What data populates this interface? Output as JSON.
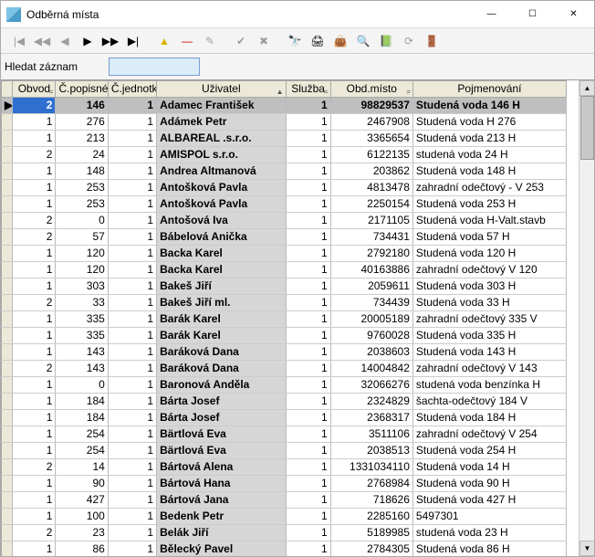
{
  "window": {
    "title": "Odběrná místa",
    "min": "—",
    "max": "☐",
    "close": "✕"
  },
  "toolbar": {
    "items": [
      {
        "name": "nav-first-icon",
        "glyph": "|◀",
        "enabled": false
      },
      {
        "name": "nav-prev-icon",
        "glyph": "◀◀",
        "enabled": false
      },
      {
        "name": "nav-back-icon",
        "glyph": "◀",
        "enabled": false
      },
      {
        "name": "nav-play-icon",
        "glyph": "▶",
        "enabled": true
      },
      {
        "name": "nav-fwd-icon",
        "glyph": "▶▶",
        "enabled": true
      },
      {
        "name": "nav-last-icon",
        "glyph": "▶|",
        "enabled": true
      },
      {
        "name": "sep"
      },
      {
        "name": "up-icon",
        "glyph": "▲",
        "enabled": true,
        "color": "#d8b400"
      },
      {
        "name": "minus-icon",
        "glyph": "—",
        "enabled": true,
        "color": "#d40000"
      },
      {
        "name": "edit-icon",
        "glyph": "✎",
        "enabled": false
      },
      {
        "name": "sep"
      },
      {
        "name": "commit-icon",
        "glyph": "✔",
        "enabled": false
      },
      {
        "name": "cancel-icon",
        "glyph": "✖",
        "enabled": false
      },
      {
        "name": "sep"
      },
      {
        "name": "binoculars-icon",
        "glyph": "🔭",
        "enabled": true
      },
      {
        "name": "print-icon",
        "glyph": "🖨",
        "enabled": true
      },
      {
        "name": "bag-icon",
        "glyph": "👜",
        "enabled": true
      },
      {
        "name": "zoom-icon",
        "glyph": "🔍",
        "enabled": true
      },
      {
        "name": "book-icon",
        "glyph": "📗",
        "enabled": true
      },
      {
        "name": "refresh-icon",
        "glyph": "⟳",
        "enabled": false
      },
      {
        "name": "door-icon",
        "glyph": "🚪",
        "enabled": true
      }
    ]
  },
  "search": {
    "label": "Hledat záznam",
    "value": ""
  },
  "columns": [
    {
      "key": "obvod",
      "label": "Obvod",
      "sort": "="
    },
    {
      "key": "popis",
      "label": "Č.popisné",
      "sort": ""
    },
    {
      "key": "jedn",
      "label": "Č.jednotk",
      "sort": ""
    },
    {
      "key": "uziv",
      "label": "Uživatel",
      "sort": "▲"
    },
    {
      "key": "sluz",
      "label": "Služba",
      "sort": "="
    },
    {
      "key": "obdm",
      "label": "Obd.místo",
      "sort": "="
    },
    {
      "key": "pojm",
      "label": "Pojmenování",
      "sort": ""
    }
  ],
  "rows": [
    {
      "sel": true,
      "obvod": "2",
      "popis": "146",
      "jedn": "1",
      "uziv": "Adamec František",
      "sluz": "1",
      "obdm": "98829537",
      "pojm": "Studená voda  146 H"
    },
    {
      "obvod": "1",
      "popis": "276",
      "jedn": "1",
      "uziv": "Adámek Petr",
      "sluz": "1",
      "obdm": "2467908",
      "pojm": "Studená voda  H  276"
    },
    {
      "obvod": "1",
      "popis": "213",
      "jedn": "1",
      "uziv": "ALBAREAL .s.r.o.",
      "sluz": "1",
      "obdm": "3365654",
      "pojm": "Studená voda   213  H"
    },
    {
      "obvod": "2",
      "popis": "24",
      "jedn": "1",
      "uziv": "AMISPOL s.r.o.",
      "sluz": "1",
      "obdm": "6122135",
      "pojm": "studená voda 24  H"
    },
    {
      "obvod": "1",
      "popis": "148",
      "jedn": "1",
      "uziv": "Andrea Altmanová",
      "sluz": "1",
      "obdm": "203862",
      "pojm": "Studená voda  148   H"
    },
    {
      "obvod": "1",
      "popis": "253",
      "jedn": "1",
      "uziv": "Antošková Pavla",
      "sluz": "1",
      "obdm": "4813478",
      "pojm": "zahradní odečtový - V  253"
    },
    {
      "obvod": "1",
      "popis": "253",
      "jedn": "1",
      "uziv": "Antošková Pavla",
      "sluz": "1",
      "obdm": "2250154",
      "pojm": "Studená voda  253   H"
    },
    {
      "obvod": "2",
      "popis": "0",
      "jedn": "1",
      "uziv": "Antošová Iva",
      "sluz": "1",
      "obdm": "2171105",
      "pojm": "Studená voda   H-Valt.stavb"
    },
    {
      "obvod": "2",
      "popis": "57",
      "jedn": "1",
      "uziv": "Bábelová Anička",
      "sluz": "1",
      "obdm": "734431",
      "pojm": "Studená voda  57   H"
    },
    {
      "obvod": "1",
      "popis": "120",
      "jedn": "1",
      "uziv": "Backa Karel",
      "sluz": "1",
      "obdm": "2792180",
      "pojm": "Studená voda  120   H"
    },
    {
      "obvod": "1",
      "popis": "120",
      "jedn": "1",
      "uziv": "Backa Karel",
      "sluz": "1",
      "obdm": "40163886",
      "pojm": "zahradní odečtový   V  120"
    },
    {
      "obvod": "1",
      "popis": "303",
      "jedn": "1",
      "uziv": "Bakeš Jiří",
      "sluz": "1",
      "obdm": "2059611",
      "pojm": "Studená voda   303   H"
    },
    {
      "obvod": "2",
      "popis": "33",
      "jedn": "1",
      "uziv": "Bakeš Jiří ml.",
      "sluz": "1",
      "obdm": "734439",
      "pojm": "Studená voda  33   H"
    },
    {
      "obvod": "1",
      "popis": "335",
      "jedn": "1",
      "uziv": "Barák Karel",
      "sluz": "1",
      "obdm": "20005189",
      "pojm": "zahradní odečtový 335   V"
    },
    {
      "obvod": "1",
      "popis": "335",
      "jedn": "1",
      "uziv": "Barák Karel",
      "sluz": "1",
      "obdm": "9760028",
      "pojm": "Studená voda 335   H"
    },
    {
      "obvod": "1",
      "popis": "143",
      "jedn": "1",
      "uziv": "Baráková Dana",
      "sluz": "1",
      "obdm": "2038603",
      "pojm": "Studená voda 143  H"
    },
    {
      "obvod": "2",
      "popis": "143",
      "jedn": "1",
      "uziv": "Baráková Dana",
      "sluz": "1",
      "obdm": "14004842",
      "pojm": "zahradní odečtový V  143"
    },
    {
      "obvod": "1",
      "popis": "0",
      "jedn": "1",
      "uziv": "Baronová Anděla",
      "sluz": "1",
      "obdm": "32066276",
      "pojm": "studená voda benzínka  H"
    },
    {
      "obvod": "1",
      "popis": "184",
      "jedn": "1",
      "uziv": "Bárta Josef",
      "sluz": "1",
      "obdm": "2324829",
      "pojm": "šachta-odečtový  184  V"
    },
    {
      "obvod": "1",
      "popis": "184",
      "jedn": "1",
      "uziv": "Bárta Josef",
      "sluz": "1",
      "obdm": "2368317",
      "pojm": "Studená voda 184    H"
    },
    {
      "obvod": "1",
      "popis": "254",
      "jedn": "1",
      "uziv": "Bärtlová Eva",
      "sluz": "1",
      "obdm": "3511106",
      "pojm": "zahradní odečtový   V  254"
    },
    {
      "obvod": "1",
      "popis": "254",
      "jedn": "1",
      "uziv": "Bärtlová Eva",
      "sluz": "1",
      "obdm": "2038513",
      "pojm": "Studená voda 254  H"
    },
    {
      "obvod": "2",
      "popis": "14",
      "jedn": "1",
      "uziv": "Bártová Alena",
      "sluz": "1",
      "obdm": "1331034110",
      "pojm": "Studená voda   14    H"
    },
    {
      "obvod": "1",
      "popis": "90",
      "jedn": "1",
      "uziv": "Bártová Hana",
      "sluz": "1",
      "obdm": "2768984",
      "pojm": "Studená voda   90    H"
    },
    {
      "obvod": "1",
      "popis": "427",
      "jedn": "1",
      "uziv": "Bártová Jana",
      "sluz": "1",
      "obdm": "718626",
      "pojm": "Studená voda   427  H"
    },
    {
      "obvod": "1",
      "popis": "100",
      "jedn": "1",
      "uziv": "Bedenk Petr",
      "sluz": "1",
      "obdm": "2285160",
      "pojm": "5497301"
    },
    {
      "obvod": "2",
      "popis": "23",
      "jedn": "1",
      "uziv": "Belák Jiří",
      "sluz": "1",
      "obdm": "5189985",
      "pojm": "studená voda 23  H"
    },
    {
      "obvod": "1",
      "popis": "86",
      "jedn": "1",
      "uziv": "Bělecký Pavel",
      "sluz": "1",
      "obdm": "2784305",
      "pojm": "Studená voda    86  H"
    }
  ]
}
